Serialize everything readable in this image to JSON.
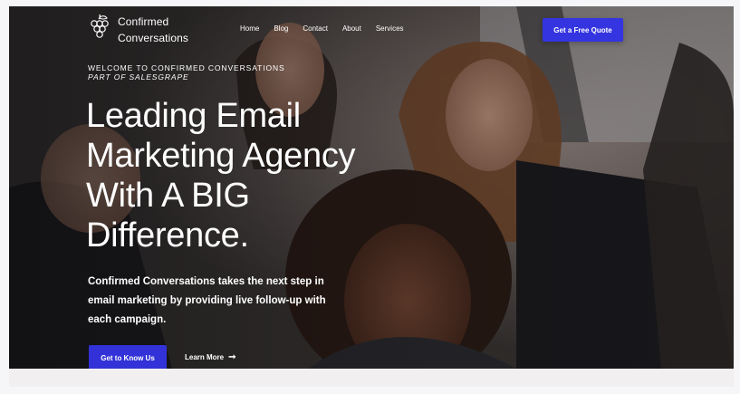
{
  "brand": {
    "name_line1": "Confirmed",
    "name_line2": "Conversations",
    "icon": "grape-cluster-icon"
  },
  "nav": {
    "items": [
      {
        "label": "Home"
      },
      {
        "label": "Blog"
      },
      {
        "label": "Contact"
      },
      {
        "label": "About"
      },
      {
        "label": "Services"
      }
    ],
    "cta_label": "Get a Free Quote"
  },
  "hero": {
    "eyebrow": "WELCOME TO CONFIRMED CONVERSATIONS",
    "eyebrow_sub": "PART OF SALESGRAPE",
    "headline": "Leading Email Marketing Agency With A BIG Difference.",
    "description": "Confirmed Conversations takes the next step in email marketing by providing live follow-up with each campaign.",
    "primary_button": "Get to Know Us",
    "secondary_link": "Learn More",
    "secondary_icon": "arrow-right-icon"
  },
  "colors": {
    "accent": "#3434e0",
    "text": "#ffffff"
  }
}
